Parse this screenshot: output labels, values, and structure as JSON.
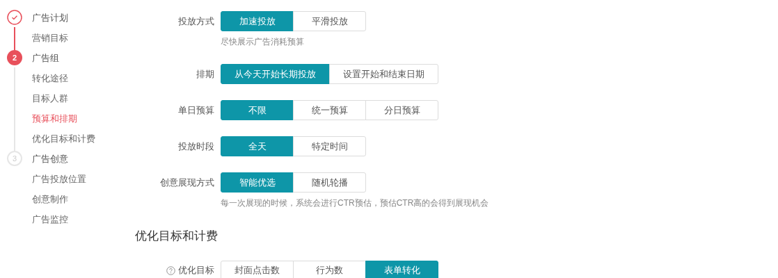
{
  "steps": [
    {
      "completed": true,
      "selected": false,
      "title": "广告计划",
      "items": [
        {
          "label": "营销目标",
          "selected": false
        }
      ]
    },
    {
      "number": "2",
      "completed": false,
      "selected": true,
      "title": "广告组",
      "items": [
        {
          "label": "转化途径",
          "selected": false
        },
        {
          "label": "目标人群",
          "selected": false
        },
        {
          "label": "预算和排期",
          "selected": true
        },
        {
          "label": "优化目标和计费",
          "selected": false
        }
      ]
    },
    {
      "number": "3",
      "completed": false,
      "selected": false,
      "title": "广告创意",
      "items": [
        {
          "label": "广告投放位置",
          "selected": false
        },
        {
          "label": "创意制作",
          "selected": false
        },
        {
          "label": "广告监控",
          "selected": false
        }
      ]
    }
  ],
  "fields": [
    {
      "label": "投放方式",
      "options": [
        {
          "label": "加速投放",
          "selected": true
        },
        {
          "label": "平滑投放",
          "selected": false
        }
      ],
      "hint": "尽快展示广告消耗预算"
    },
    {
      "label": "排期",
      "options": [
        {
          "label": "从今天开始长期投放",
          "selected": true
        },
        {
          "label": "设置开始和结束日期",
          "selected": false
        }
      ]
    },
    {
      "label": "单日预算",
      "options": [
        {
          "label": "不限",
          "selected": true
        },
        {
          "label": "统一预算",
          "selected": false
        },
        {
          "label": "分日预算",
          "selected": false
        }
      ]
    },
    {
      "label": "投放时段",
      "options": [
        {
          "label": "全天",
          "selected": true
        },
        {
          "label": "特定时间",
          "selected": false
        }
      ]
    },
    {
      "label": "创意展现方式",
      "options": [
        {
          "label": "智能优选",
          "selected": true
        },
        {
          "label": "随机轮播",
          "selected": false
        }
      ],
      "hint": "每一次展现的时候，系统会进行CTR预估，预估CTR高的会得到展现机会"
    }
  ],
  "section": {
    "title": "优化目标和计费",
    "fields": [
      {
        "label": "优化目标",
        "help": true,
        "options": [
          {
            "label": "封面点击数",
            "selected": false
          },
          {
            "label": "行为数",
            "selected": false
          },
          {
            "label": "表单转化",
            "selected": true
          }
        ]
      }
    ]
  }
}
